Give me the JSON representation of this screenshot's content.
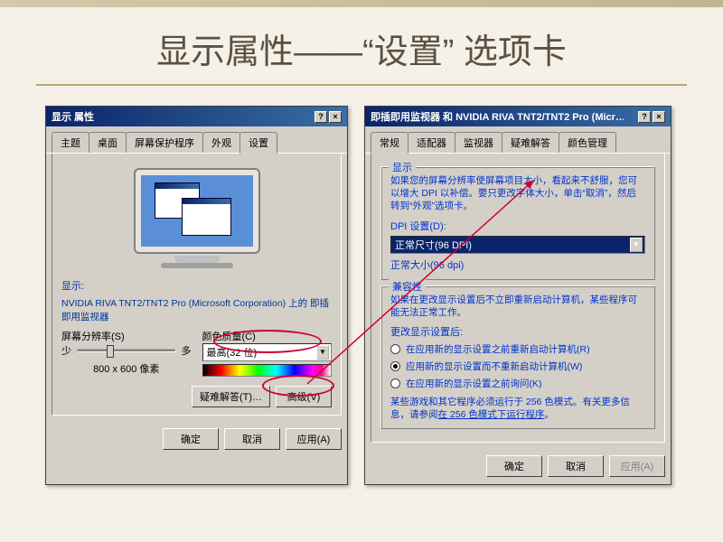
{
  "slide": {
    "title": "显示属性——“设置” 选项卡"
  },
  "dialog_left": {
    "title": "显示 属性",
    "tabs": [
      "主题",
      "桌面",
      "屏幕保护程序",
      "外观",
      "设置"
    ],
    "active_tab": 4,
    "display_label": "显示:",
    "display_value": "NVIDIA RIVA TNT2/TNT2 Pro (Microsoft Corporation) 上的 即插即用监视器",
    "resolution_label": "屏幕分辨率(S)",
    "slider_min": "少",
    "slider_max": "多",
    "resolution_value": "800 x 600 像素",
    "color_label": "颜色质量(C)",
    "color_value": "最高(32 位)",
    "troubleshoot_btn": "疑难解答(T)…",
    "advanced_btn": "高级(V)",
    "ok_btn": "确定",
    "cancel_btn": "取消",
    "apply_btn": "应用(A)"
  },
  "dialog_right": {
    "title": "即插即用监视器 和 NVIDIA RIVA TNT2/TNT2 Pro (Micr…",
    "tabs": [
      "常规",
      "适配器",
      "监视器",
      "疑难解答",
      "颜色管理"
    ],
    "active_tab": 0,
    "group1_title": "显示",
    "group1_text": "如果您的屏幕分辨率使屏幕项目太小，看起来不舒服，您可以增大 DPI 以补偿。要只更改字体大小，单击“取消”，然后转到“外观”选项卡。",
    "dpi_label": "DPI 设置(D):",
    "dpi_value": "正常尺寸(96 DPI)",
    "dpi_normal": "正常大小(96 dpi)",
    "group2_title": "兼容性",
    "group2_text": "如果在更改显示设置后不立即重新启动计算机，某些程序可能无法正常工作。",
    "change_label": "更改显示设置后:",
    "radio1": "在应用新的显示设置之前重新启动计算机(R)",
    "radio2": "应用新的显示设置而不重新启动计算机(W)",
    "radio3": "在应用新的显示设置之前询问(K)",
    "games_text1": "某些游戏和其它程序必须运行于 256 色模式。有关更多信息，请参阅",
    "games_link": "在 256 色模式下运行程序",
    "ok_btn": "确定",
    "cancel_btn": "取消",
    "apply_btn": "应用(A)"
  }
}
